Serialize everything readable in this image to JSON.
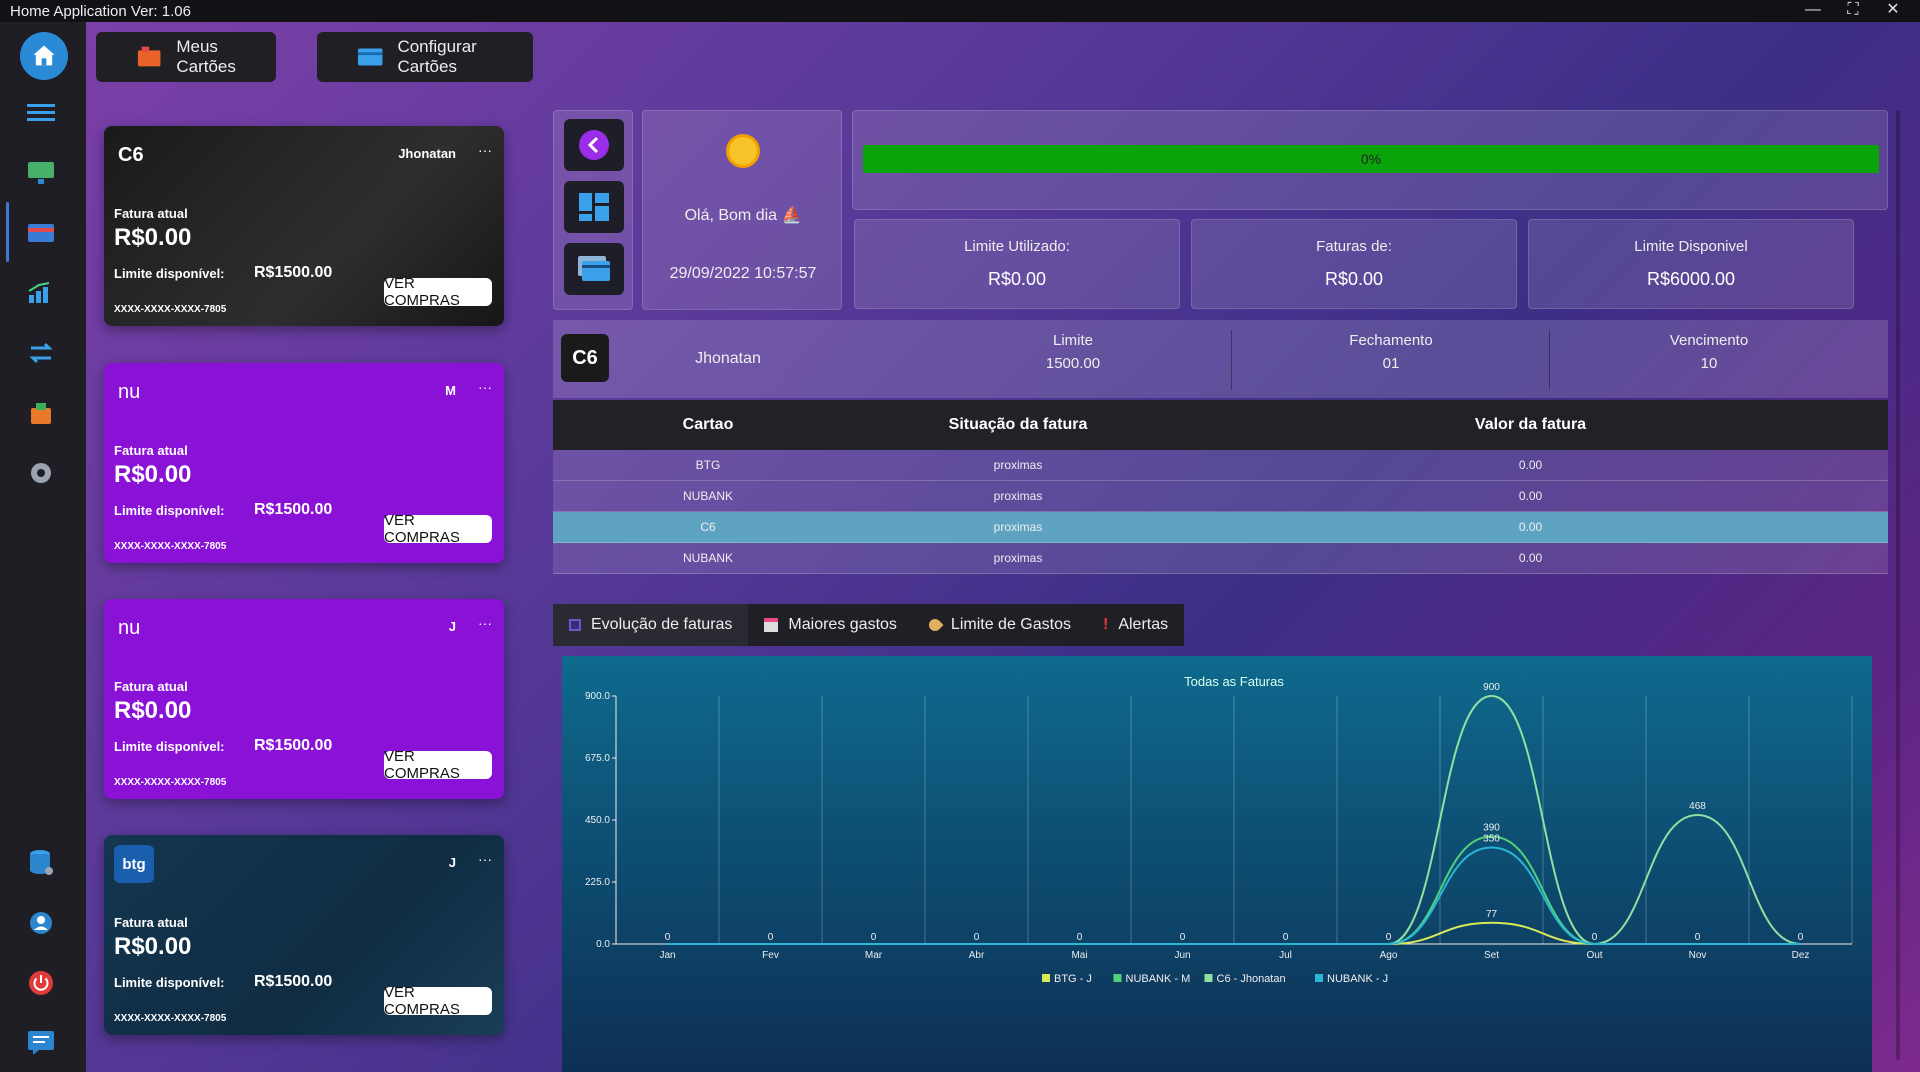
{
  "window": {
    "title": "Home Application Ver: 1.06"
  },
  "top_buttons": {
    "meus_cartoes": "Meus Cartões",
    "configurar": "Configurar Cartões"
  },
  "cards": [
    {
      "brand": "C6",
      "owner": "Jhonatan",
      "dots": "···",
      "invoice_label": "Fatura atual",
      "invoice": "R$0.00",
      "limit_label": "Limite disponível:",
      "limit": "R$1500.00",
      "number": "XXXX-XXXX-XXXX-7805",
      "button": "VER COMPRAS",
      "color": "#1e1e1e"
    },
    {
      "brand": "nu",
      "owner": "M",
      "dots": "···",
      "invoice_label": "Fatura atual",
      "invoice": "R$0.00",
      "limit_label": "Limite disponível:",
      "limit": "R$1500.00",
      "number": "XXXX-XXXX-XXXX-7805",
      "button": "VER COMPRAS",
      "color": "#8a12d6"
    },
    {
      "brand": "nu",
      "owner": "J",
      "dots": "···",
      "invoice_label": "Fatura atual",
      "invoice": "R$0.00",
      "limit_label": "Limite disponível:",
      "limit": "R$1500.00",
      "number": "XXXX-XXXX-XXXX-7805",
      "button": "VER COMPRAS",
      "color": "#8a12d6"
    },
    {
      "brand": "btg",
      "owner": "J",
      "dots": "···",
      "invoice_label": "Fatura atual",
      "invoice": "R$0.00",
      "limit_label": "Limite disponível:",
      "limit": "R$1500.00",
      "number": "XXXX-XXXX-XXXX-7805",
      "button": "VER COMPRAS",
      "color": "#12324a"
    }
  ],
  "greeting": {
    "text": "Olá, Bom dia",
    "datetime": "29/09/2022 10:57:57"
  },
  "progress": {
    "label": "0%",
    "value": 0
  },
  "stats": [
    {
      "label": "Limite Utilizado:",
      "value": "R$0.00"
    },
    {
      "label": "Faturas de:",
      "value": "R$0.00"
    },
    {
      "label": "Limite Disponivel",
      "value": "R$6000.00"
    }
  ],
  "info": {
    "brand": "C6",
    "owner": "Jhonatan",
    "limite_label": "Limite",
    "limite": "1500.00",
    "fechamento_label": "Fechamento",
    "fechamento": "01",
    "vencimento_label": "Vencimento",
    "vencimento": "10"
  },
  "table": {
    "headers": [
      "Cartao",
      "Situação da fatura",
      "Valor da fatura"
    ],
    "rows": [
      [
        "BTG",
        "proximas",
        "0.00"
      ],
      [
        "NUBANK",
        "proximas",
        "0.00"
      ],
      [
        "C6",
        "proximas",
        "0.00"
      ],
      [
        "NUBANK",
        "proximas",
        "0.00"
      ]
    ]
  },
  "tabs": [
    "Evolução de faturas",
    "Maiores gastos",
    "Limite de Gastos",
    "Alertas"
  ],
  "icons": [
    "home-icon",
    "menu-icon",
    "monitor-icon",
    "card-icon",
    "chart-icon",
    "transfer-icon",
    "bag-icon",
    "gear-icon",
    "database-icon",
    "user-icon",
    "power-icon",
    "message-icon"
  ],
  "chart_data": {
    "type": "line",
    "title": "Todas as Faturas",
    "categories": [
      "Jan",
      "Fev",
      "Mar",
      "Abr",
      "Mai",
      "Jun",
      "Jul",
      "Ago",
      "Set",
      "Out",
      "Nov",
      "Dez"
    ],
    "ylim": [
      0,
      900
    ],
    "yticks": [
      "0.0",
      "225.0",
      "450.0",
      "675.0",
      "900.0"
    ],
    "grid": true,
    "legend_position": "bottom",
    "series": [
      {
        "name": "BTG - J",
        "color": "#d7e85a",
        "values": [
          0,
          0,
          0,
          0,
          0,
          0,
          0,
          0,
          77,
          0,
          0,
          0
        ]
      },
      {
        "name": "NUBANK - M",
        "color": "#4fd17a",
        "values": [
          0,
          0,
          0,
          0,
          0,
          0,
          0,
          0,
          390,
          0,
          0,
          0
        ]
      },
      {
        "name": "C6 - Jhonatan",
        "color": "#8fe0a0",
        "values": [
          0,
          0,
          0,
          0,
          0,
          0,
          0,
          0,
          900,
          0,
          468,
          0
        ]
      },
      {
        "name": "NUBANK - J",
        "color": "#2bb6d6",
        "values": [
          0,
          0,
          0,
          0,
          0,
          0,
          0,
          0,
          350,
          0,
          0,
          0
        ]
      }
    ],
    "labels": [
      "0",
      "0",
      "0",
      "0",
      "0",
      "0",
      "0",
      "0",
      "0",
      "0",
      "0",
      "0",
      "0",
      "0",
      "0",
      "0",
      "0",
      "77",
      "390",
      "350",
      "468",
      "0",
      "0",
      "0"
    ]
  }
}
